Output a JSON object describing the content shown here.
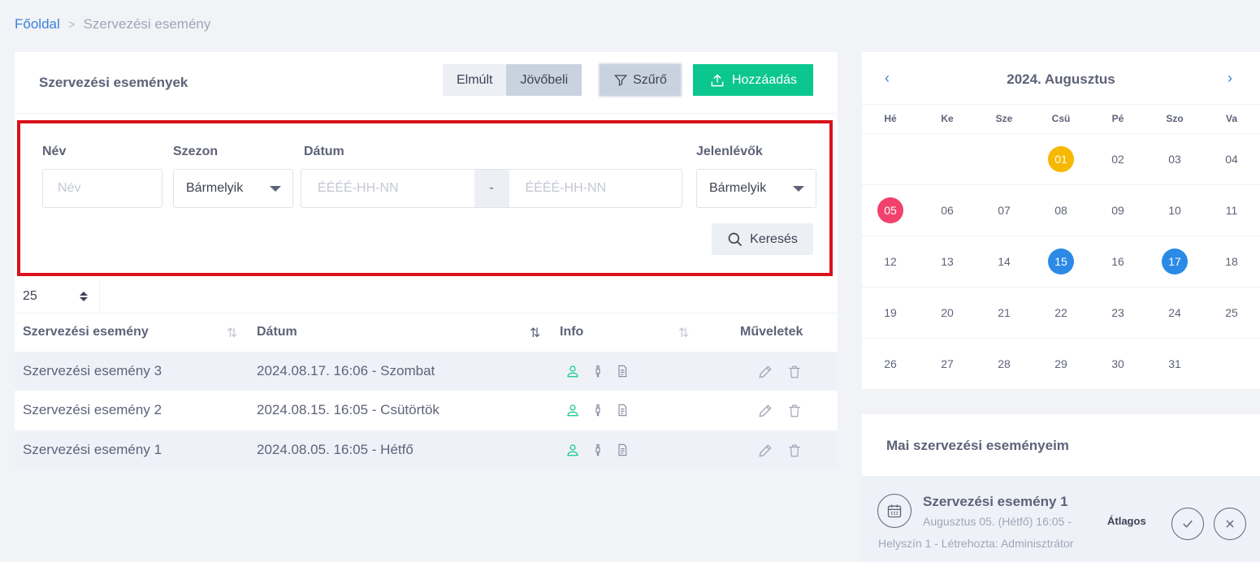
{
  "breadcrumb": {
    "home": "Főoldal",
    "separator": ">",
    "current": "Szervezési esemény"
  },
  "card": {
    "title": "Szervezési események",
    "toggle": {
      "past": "Elmúlt",
      "future": "Jövőbeli"
    },
    "filter_label": "Szűrő",
    "add_label": "Hozzáadás"
  },
  "filters": {
    "name": {
      "label": "Név",
      "placeholder": "Név"
    },
    "season": {
      "label": "Szezon",
      "value": "Bármelyik"
    },
    "date": {
      "label": "Dátum",
      "from_placeholder": "ÉÉÉÉ-HH-NN",
      "dash": "-",
      "to_placeholder": "ÉÉÉÉ-HH-NN"
    },
    "attendees": {
      "label": "Jelenlévők",
      "value": "Bármelyik"
    },
    "search_label": "Keresés"
  },
  "page_size": "25",
  "table": {
    "columns": [
      "Szervezési esemény",
      "Dátum",
      "Info",
      "Műveletek"
    ],
    "rows": [
      {
        "name": "Szervezési esemény 3",
        "date": "2024.08.17. 16:06 - Szombat"
      },
      {
        "name": "Szervezési esemény 2",
        "date": "2024.08.15. 16:05 - Csütörtök"
      },
      {
        "name": "Szervezési esemény 1",
        "date": "2024.08.05. 16:05 - Hétfő"
      }
    ]
  },
  "calendar": {
    "title": "2024. Augusztus",
    "prev": "‹",
    "next": "›",
    "weekdays": [
      "Hé",
      "Ke",
      "Sze",
      "Csü",
      "Pé",
      "Szo",
      "Va"
    ],
    "weeks": [
      [
        "",
        "",
        "",
        "01",
        "02",
        "03",
        "04"
      ],
      [
        "05",
        "06",
        "07",
        "08",
        "09",
        "10",
        "11"
      ],
      [
        "12",
        "13",
        "14",
        "15",
        "16",
        "17",
        "18"
      ],
      [
        "19",
        "20",
        "21",
        "22",
        "23",
        "24",
        "25"
      ],
      [
        "26",
        "27",
        "28",
        "29",
        "30",
        "31",
        ""
      ]
    ],
    "highlights": {
      "01": "yellow",
      "05": "red",
      "15": "blue",
      "17": "blue"
    }
  },
  "today": {
    "title": "Mai szervezési eseményeim",
    "event": {
      "title": "Szervezési esemény 1",
      "subtitle": "Augusztus 05. (Hétfő) 16:05 -",
      "subtitle2": "Helyszín 1 - Létrehozta: Adminisztrátor",
      "level": "Átlagos"
    }
  },
  "colors": {
    "accent": "#0bc68f",
    "link": "#3b82d8",
    "filter_border": "#d9121b",
    "info_person": "#0bc68f"
  }
}
